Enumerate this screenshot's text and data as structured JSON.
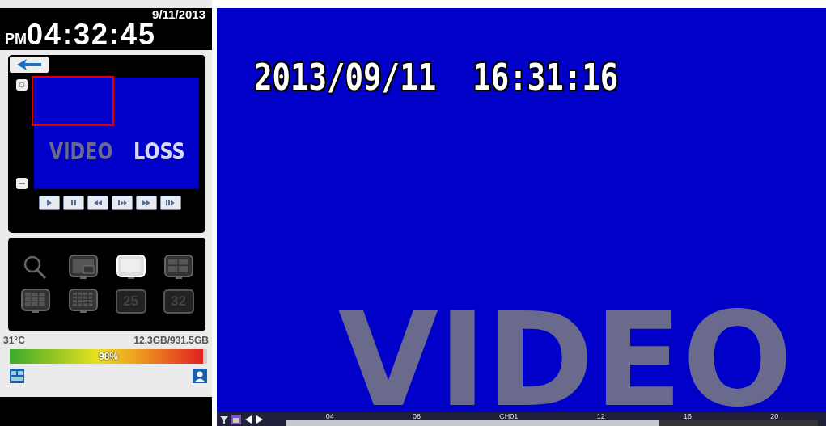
{
  "clock": {
    "date": "9/11/2013",
    "meridiem": "PM",
    "time": "04:32:45"
  },
  "preview": {
    "overlay": [
      "VIDEO",
      "LOSS"
    ]
  },
  "playback_buttons": [
    {
      "kind": "play"
    },
    {
      "kind": "pause"
    },
    {
      "kind": "rewind"
    },
    {
      "kind": "step"
    },
    {
      "kind": "forward"
    },
    {
      "kind": "fast"
    }
  ],
  "layout_buttons": [
    {
      "kind": "search",
      "selected": false
    },
    {
      "kind": "pip",
      "selected": false
    },
    {
      "kind": "single",
      "selected": true
    },
    {
      "kind": "quad",
      "selected": false
    },
    {
      "kind": "nine",
      "selected": false
    },
    {
      "kind": "sixteen",
      "selected": false
    },
    {
      "kind": "number",
      "label": "25",
      "selected": false
    },
    {
      "kind": "number",
      "label": "32",
      "selected": false
    }
  ],
  "status": {
    "temperature": "31°C",
    "storage": "12.3GB/931.5GB",
    "usage": "98%",
    "level": 0.98
  },
  "camera_view": {
    "timestamp": "2013/09/11  16:31:16",
    "overlay": "VIDEO"
  },
  "timeline": {
    "channel": "CH01",
    "hours": [
      "04",
      "08",
      "12",
      "16",
      "20"
    ],
    "level": 0.7
  }
}
